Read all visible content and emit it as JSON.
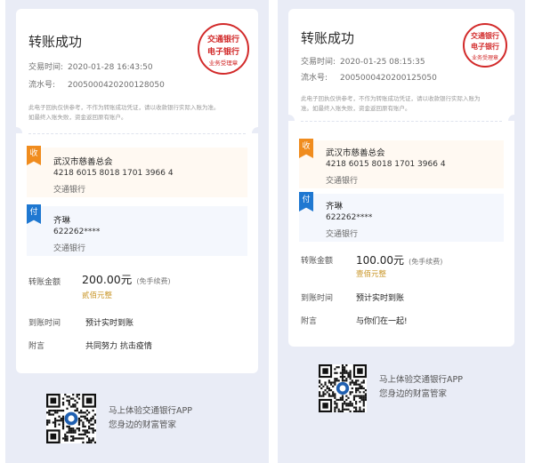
{
  "receipts": [
    {
      "title": "转账成功",
      "time_label": "交易时间:",
      "time_value": "2020-01-28 16:43:50",
      "serial_label": "流水号:",
      "serial_value": "2005000420200128050",
      "disclaimer": "此电子回执仅供参考，不作为转账成功凭证，请以收款银行实际入账为准。如最终入账失败，资金返回原有账户。",
      "seal": {
        "top": "交通银行",
        "middle": "电子银行",
        "bottom": "业务受理章",
        "color": "#d22a2a"
      },
      "payee": {
        "tag": "收",
        "name": "武汉市慈善总会",
        "account": "4218 6015 8018 1701 3966 4",
        "bank": "交通银行"
      },
      "payer": {
        "tag": "付",
        "name": "齐琳",
        "account": "622262****",
        "bank": "交通银行"
      },
      "amount_label": "转账金额",
      "amount_value": "200.00元",
      "fee_note": "(免手续费)",
      "amount_chinese": "贰佰元整",
      "arrival_label": "到账时间",
      "arrival_value": "预计实时到账",
      "note_label": "附言",
      "note_value": "共同努力 抗击疫情",
      "promo_line1": "马上体验交通银行APP",
      "promo_line2": "您身边的财富管家"
    },
    {
      "title": "转账成功",
      "time_label": "交易时间:",
      "time_value": "2020-01-25 08:15:35",
      "serial_label": "流水号:",
      "serial_value": "2005000420200125050",
      "disclaimer": "此电子回执仅供参考，不作为转账成功凭证，请以收款银行实际入账为准。如最终入账失败，资金返回原有账户。",
      "seal": {
        "top": "交通银行",
        "middle": "电子银行",
        "bottom": "业务受理章",
        "color": "#d22a2a"
      },
      "payee": {
        "tag": "收",
        "name": "武汉市慈善总会",
        "account": "4218 6015 8018 1701 3966 4",
        "bank": "交通银行"
      },
      "payer": {
        "tag": "付",
        "name": "齐琳",
        "account": "622262****",
        "bank": "交通银行"
      },
      "amount_label": "转账金额",
      "amount_value": "100.00元",
      "fee_note": "(免手续费)",
      "amount_chinese": "壹佰元整",
      "arrival_label": "到账时间",
      "arrival_value": "预计实时到账",
      "note_label": "附言",
      "note_value": "与你们在一起!",
      "promo_line1": "马上体验交通银行APP",
      "promo_line2": "您身边的财富管家"
    }
  ],
  "colors": {
    "accent_orange": "#f08c1e",
    "accent_blue": "#1f78d1",
    "seal_red": "#d22a2a",
    "amount_gold": "#c89424"
  }
}
